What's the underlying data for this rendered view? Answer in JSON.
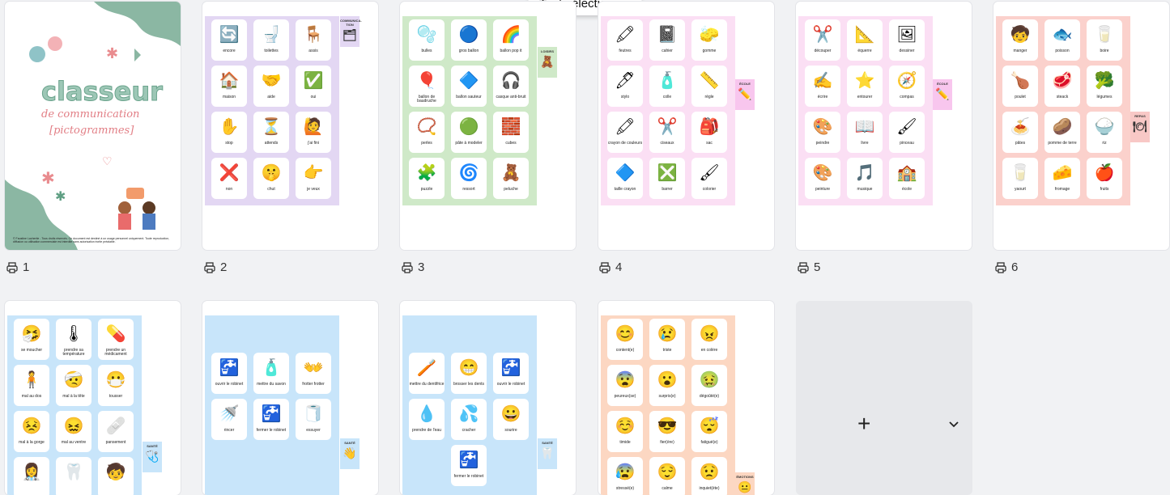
{
  "tooltip": "Tout sélectionner",
  "cover": {
    "title": "classeur",
    "subtitle": "de communication",
    "subtitle2": "[pictogrammes]",
    "footer": "© Faustine Lachertie - Tous droits réservés. Ce document est destiné à un usage personnel uniquement. Toute reproduction, diffusion ou utilisation commerciale est interdite sans autorisation écrite préalable."
  },
  "pages": [
    {
      "number": "1"
    },
    {
      "number": "2",
      "tab": "COMMUNICA-TION",
      "tab_icon": "🗂",
      "items": [
        {
          "label": "encore",
          "icon": "🔄"
        },
        {
          "label": "toilettes",
          "icon": "🚽"
        },
        {
          "label": "assis",
          "icon": "🪑"
        },
        {
          "label": "maison",
          "icon": "🏠"
        },
        {
          "label": "aide",
          "icon": "🤝"
        },
        {
          "label": "oui",
          "icon": "✅"
        },
        {
          "label": "stop",
          "icon": "✋"
        },
        {
          "label": "attends",
          "icon": "⏳"
        },
        {
          "label": "j'ai fini",
          "icon": "🙋"
        },
        {
          "label": "non",
          "icon": "❌"
        },
        {
          "label": "chut",
          "icon": "🤫"
        },
        {
          "label": "je veux",
          "icon": "👉"
        }
      ]
    },
    {
      "number": "3",
      "tab": "LOISIRS",
      "tab_icon": "🧸",
      "items": [
        {
          "label": "bulles",
          "icon": "🫧"
        },
        {
          "label": "gros ballon",
          "icon": "🔵"
        },
        {
          "label": "ballon pop it",
          "icon": "🌈"
        },
        {
          "label": "ballon de baudruche",
          "icon": "🎈"
        },
        {
          "label": "ballon sauteur",
          "icon": "🔷"
        },
        {
          "label": "casque anti-bruit",
          "icon": "🎧"
        },
        {
          "label": "perles",
          "icon": "📿"
        },
        {
          "label": "pâte à modeler",
          "icon": "🟢"
        },
        {
          "label": "cubes",
          "icon": "🧱"
        },
        {
          "label": "puzzle",
          "icon": "🧩"
        },
        {
          "label": "ressort",
          "icon": "🌀"
        },
        {
          "label": "peluche",
          "icon": "🧸"
        }
      ]
    },
    {
      "number": "4",
      "tab": "ÉCOLE",
      "tab_icon": "✏️",
      "items": [
        {
          "label": "feutres",
          "icon": "🖍"
        },
        {
          "label": "cahier",
          "icon": "📓"
        },
        {
          "label": "gomme",
          "icon": "🧽"
        },
        {
          "label": "stylo",
          "icon": "🖊"
        },
        {
          "label": "colle",
          "icon": "🧴"
        },
        {
          "label": "règle",
          "icon": "📏"
        },
        {
          "label": "crayon de couleurs",
          "icon": "🖍"
        },
        {
          "label": "ciseaux",
          "icon": "✂️"
        },
        {
          "label": "sac",
          "icon": "🎒"
        },
        {
          "label": "taille crayon",
          "icon": "🔷"
        },
        {
          "label": "barrer",
          "icon": "❎"
        },
        {
          "label": "colorier",
          "icon": "🖌"
        }
      ]
    },
    {
      "number": "5",
      "tab": "ÉCOLE",
      "tab_icon": "✏️",
      "items": [
        {
          "label": "découper",
          "icon": "✂️"
        },
        {
          "label": "équerre",
          "icon": "📐"
        },
        {
          "label": "dessiner",
          "icon": "🖼"
        },
        {
          "label": "écrire",
          "icon": "✍️"
        },
        {
          "label": "entourer",
          "icon": "⭐"
        },
        {
          "label": "compas",
          "icon": "🧭"
        },
        {
          "label": "peindre",
          "icon": "🎨"
        },
        {
          "label": "livre",
          "icon": "📖"
        },
        {
          "label": "pinceau",
          "icon": "🖌"
        },
        {
          "label": "peinture",
          "icon": "🎨"
        },
        {
          "label": "musique",
          "icon": "🎵"
        },
        {
          "label": "école",
          "icon": "🏫"
        }
      ]
    },
    {
      "number": "6",
      "tab": "REPAS",
      "tab_icon": "🍽",
      "items": [
        {
          "label": "manger",
          "icon": "🧒"
        },
        {
          "label": "poisson",
          "icon": "🐟"
        },
        {
          "label": "boire",
          "icon": "🥛"
        },
        {
          "label": "poulet",
          "icon": "🍗"
        },
        {
          "label": "steack",
          "icon": "🥩"
        },
        {
          "label": "légumes",
          "icon": "🥦"
        },
        {
          "label": "pâtes",
          "icon": "🍝"
        },
        {
          "label": "pomme de terre",
          "icon": "🥔"
        },
        {
          "label": "riz",
          "icon": "🍚"
        },
        {
          "label": "yaourt",
          "icon": "🥛"
        },
        {
          "label": "fromage",
          "icon": "🧀"
        },
        {
          "label": "fruits",
          "icon": "🍎"
        }
      ]
    },
    {
      "number": "",
      "tab": "SANTÉ",
      "tab_icon": "🩺",
      "items": [
        {
          "label": "se moucher",
          "icon": "🤧"
        },
        {
          "label": "prendre sa température",
          "icon": "🌡"
        },
        {
          "label": "prendre un médicament",
          "icon": "💊"
        },
        {
          "label": "mal au dos",
          "icon": "🧍"
        },
        {
          "label": "mal à la tête",
          "icon": "🤕"
        },
        {
          "label": "tousser",
          "icon": "😷"
        },
        {
          "label": "mal à la gorge",
          "icon": "😣"
        },
        {
          "label": "mal au ventre",
          "icon": "😖"
        },
        {
          "label": "pansement",
          "icon": "🩹"
        },
        {
          "label": "",
          "icon": "👩‍⚕️"
        },
        {
          "label": "",
          "icon": "🦷"
        },
        {
          "label": "",
          "icon": "🧒"
        }
      ]
    },
    {
      "number": "",
      "tab": "SANTÉ",
      "tab_icon": "👋",
      "items": [
        {
          "label": "ouvrir le robinet",
          "icon": "🚰"
        },
        {
          "label": "mettre du savon",
          "icon": "🧴"
        },
        {
          "label": "frotter frotter",
          "icon": "👐"
        },
        {
          "label": "rincer",
          "icon": "🚿"
        },
        {
          "label": "fermer le robinet",
          "icon": "🚰"
        },
        {
          "label": "essuyer",
          "icon": "🧻"
        }
      ]
    },
    {
      "number": "",
      "tab": "SANTÉ",
      "tab_icon": "🦷",
      "items": [
        {
          "label": "mettre du dentifrice",
          "icon": "🪥"
        },
        {
          "label": "brosser les dents",
          "icon": "😁"
        },
        {
          "label": "ouvrir le robinet",
          "icon": "🚰"
        },
        {
          "label": "prendre de l'eau",
          "icon": "💧"
        },
        {
          "label": "cracher",
          "icon": "💦"
        },
        {
          "label": "sourire",
          "icon": "😀"
        },
        {
          "label": "",
          "icon": ""
        },
        {
          "label": "fermer le robinet",
          "icon": "🚰"
        },
        {
          "label": "",
          "icon": ""
        }
      ]
    },
    {
      "number": "",
      "tab": "ÉMOTIONS",
      "tab_icon": "😐",
      "items": [
        {
          "label": "content(e)",
          "icon": "😊"
        },
        {
          "label": "triste",
          "icon": "😢"
        },
        {
          "label": "en colère",
          "icon": "😠"
        },
        {
          "label": "peureux(se)",
          "icon": "😨"
        },
        {
          "label": "surpris(e)",
          "icon": "😮"
        },
        {
          "label": "dégoûté(e)",
          "icon": "🤢"
        },
        {
          "label": "timide",
          "icon": "☺️"
        },
        {
          "label": "fier(ère)",
          "icon": "😎"
        },
        {
          "label": "fatigué(e)",
          "icon": "😴"
        },
        {
          "label": "stressé(e)",
          "icon": "😰"
        },
        {
          "label": "calme",
          "icon": "😌"
        },
        {
          "label": "inquiet(ète)",
          "icon": "😟"
        }
      ]
    }
  ],
  "add_button": "+",
  "colors": {
    "communication": "#e3d7f3",
    "loisirs": "#cfe9c8",
    "ecole": "#fbdff4",
    "repas": "#fbd1cc",
    "sante": "#c8e5fa",
    "emotions": "#fcd7c2",
    "tab_pink": "#f8c6ee",
    "tab_repas": "#f8c8c6"
  }
}
